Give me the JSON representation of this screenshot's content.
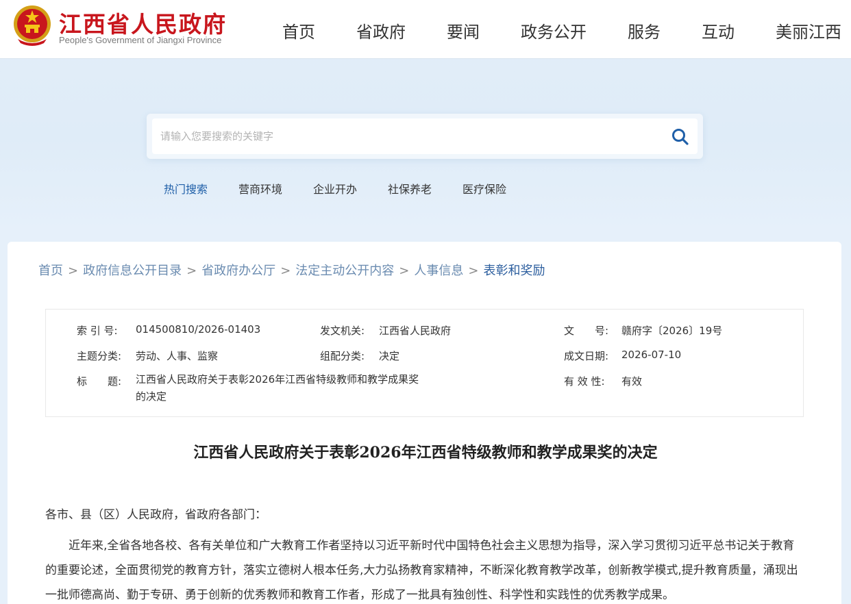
{
  "header": {
    "site_name": "江西省人民政府",
    "site_name_en": "People's Government of Jiangxi Province",
    "emblem_icon": "national-emblem-icon",
    "nav": [
      "首页",
      "省政府",
      "要闻",
      "政务公开",
      "服务",
      "互动",
      "美丽江西"
    ]
  },
  "search": {
    "placeholder": "请输入您要搜索的关键字",
    "value": "",
    "button_icon": "search-icon",
    "hot_label": "热门搜索",
    "hot_items": [
      "营商环境",
      "企业开办",
      "社保养老",
      "医疗保险"
    ]
  },
  "breadcrumb": {
    "items": [
      "首页",
      "政府信息公开目录",
      "省政府办公厅",
      "法定主动公开内容",
      "人事信息"
    ],
    "separator": ">",
    "current": "表彰和奖励"
  },
  "meta": {
    "index_label": "索 引 号:",
    "index_value": "014500810/2026-01403",
    "issuer_label": "发文机关:",
    "issuer_value": "江西省人民政府",
    "docno_label": "文　　号:",
    "docno_value": "赣府字〔2026〕19号",
    "topic_label": "主题分类:",
    "topic_value": "劳动、人事、监察",
    "category_label": "组配分类:",
    "category_value": "决定",
    "date_label": "成文日期:",
    "date_value": "2026-07-10",
    "title_label": "标　　题:",
    "title_value": "江西省人民政府关于表彰2026年江西省特级教师和教学成果奖的决定",
    "validity_label": "有 效 性:",
    "validity_value": "有效"
  },
  "document": {
    "title": "江西省人民政府关于表彰2026年江西省特级教师和教学成果奖的决定",
    "salutation": "各市、县（区）人民政府，省政府各部门：",
    "paragraph1": "近年来,全省各地各校、各有关单位和广大教育工作者坚持以习近平新时代中国特色社会主义思想为指导，深入学习贯彻习近平总书记关于教育的重要论述，全面贯彻党的教育方针，落实立德树人根本任务,大力弘扬教育家精神，不断深化教育教学改革，创新教学模式,提升教育质量，涌现出一批师德高尚、勤于专研、勇于创新的优秀教师和教育工作者，形成了一批具有独创性、科学性和实践性的优秀教学成果。"
  },
  "colors": {
    "brand_red": "#c8161d",
    "link_blue": "#1f5fa8",
    "breadcrumb_blue": "#6a8bb0",
    "page_bg": "#e3eef9"
  }
}
